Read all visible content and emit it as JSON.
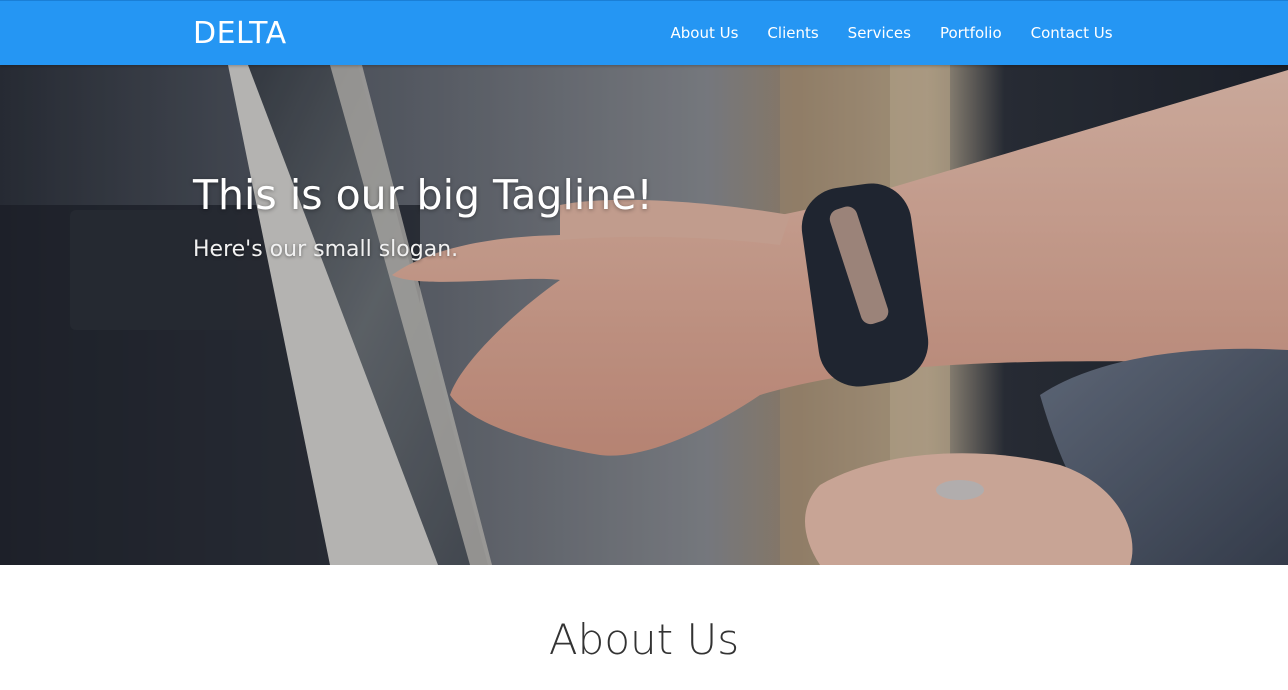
{
  "navbar": {
    "brand": "DELTA",
    "links": [
      "About Us",
      "Clients",
      "Services",
      "Portfolio",
      "Contact Us"
    ],
    "background_color": "#2596f3"
  },
  "hero": {
    "tagline": "This is our big Tagline!",
    "slogan": "Here's our small slogan."
  },
  "about": {
    "title": "About Us"
  }
}
